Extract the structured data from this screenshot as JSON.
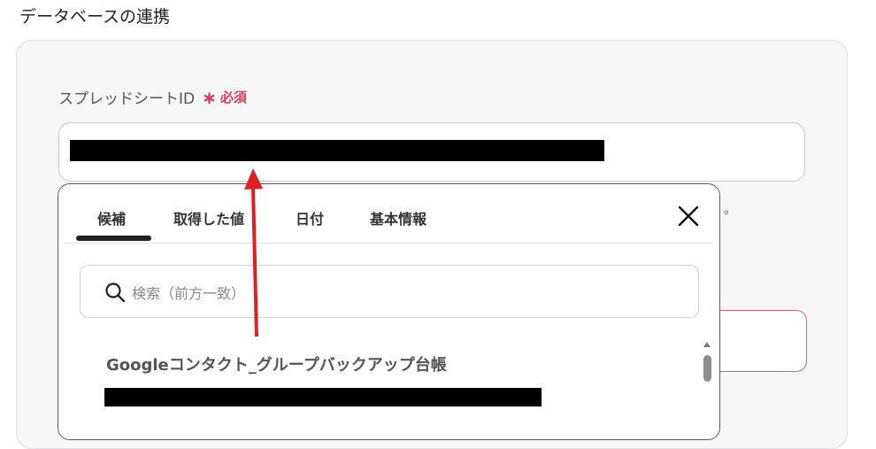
{
  "section": {
    "title": "データベースの連携"
  },
  "spreadsheet_field": {
    "label": "スプレッドシートID",
    "required_mark": "∗",
    "required_text": "必須"
  },
  "trailing_mark": "。",
  "dropdown": {
    "tabs": [
      {
        "label": "候補",
        "active": true
      },
      {
        "label": "取得した値",
        "active": false
      },
      {
        "label": "日付",
        "active": false
      },
      {
        "label": "基本情報",
        "active": false
      }
    ],
    "close_icon": "close-icon",
    "search": {
      "placeholder": "検索（前方一致）",
      "icon": "search-icon"
    },
    "options": [
      {
        "title": "Googleコンタクト_グループバックアップ台帳"
      }
    ]
  },
  "colors": {
    "required": "#e23b5a",
    "annotation_arrow": "#e02020",
    "redaction": "#000000"
  }
}
